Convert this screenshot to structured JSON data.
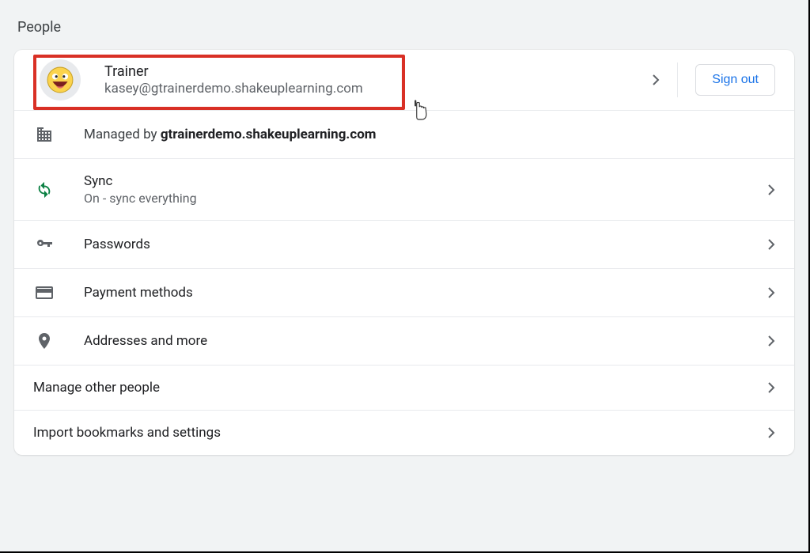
{
  "section_title": "People",
  "profile": {
    "name": "Trainer",
    "email": "kasey@gtrainerdemo.shakeuplearning.com"
  },
  "signout_label": "Sign out",
  "managed": {
    "prefix": "Managed by ",
    "domain": "gtrainerdemo.shakeuplearning.com"
  },
  "sync": {
    "title": "Sync",
    "status": "On - sync everything"
  },
  "rows": {
    "passwords": "Passwords",
    "payment": "Payment methods",
    "addresses": "Addresses and more",
    "manage_people": "Manage other people",
    "import": "Import bookmarks and settings"
  }
}
